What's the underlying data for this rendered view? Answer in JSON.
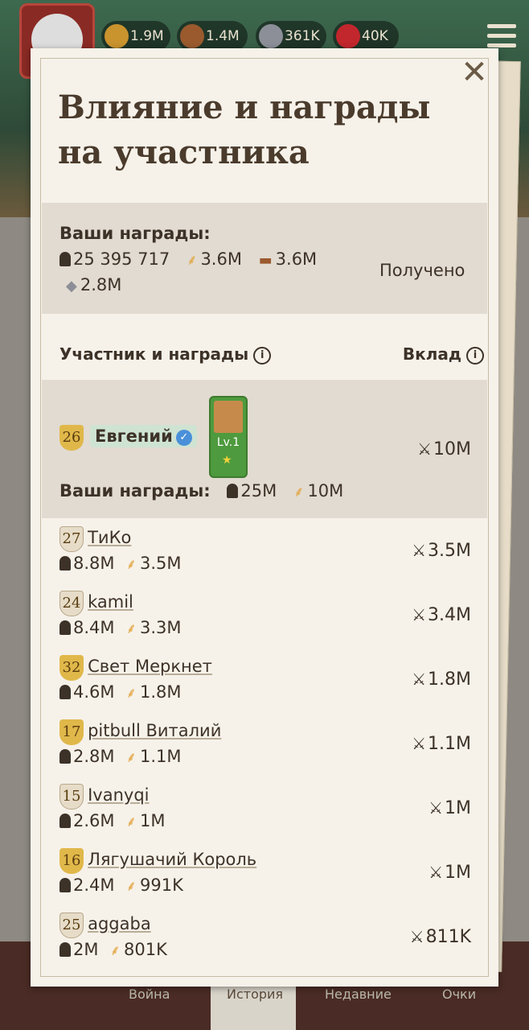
{
  "resources": {
    "grain": "1.9M",
    "wood": "1.4M",
    "stone": "361K",
    "gems": "40K"
  },
  "bottom_tabs": [
    "Война",
    "История",
    "Недавние",
    "Очки"
  ],
  "modal": {
    "title": "Влияние и награды на участника",
    "rewards": {
      "heading": "Ваши награды:",
      "line1": "25 395 717 ⚘ 3.6M ▬ 3.6M",
      "troops": "25 395 717",
      "grain": "3.6M",
      "wood": "3.6M",
      "stone": "2.8M",
      "status": "Получено"
    },
    "header_left": "Участник и награды",
    "header_right": "Вклад",
    "me": {
      "rank": "26",
      "name": "Евгений",
      "hero_level": "Lv.1",
      "contribution": "10M",
      "rewards_label": "Ваши награды:",
      "troops": "25M",
      "extra": "10M"
    },
    "members": [
      {
        "rank": "27",
        "name": "ТиКо",
        "troops": "8.8M",
        "extra": "3.5M",
        "contribution": "3.5M",
        "gold": false
      },
      {
        "rank": "24",
        "name": "kamil",
        "troops": "8.4M",
        "extra": "3.3M",
        "contribution": "3.4M",
        "gold": false
      },
      {
        "rank": "32",
        "name": "Свет Меркнет",
        "troops": "4.6M",
        "extra": "1.8M",
        "contribution": "1.8M",
        "gold": true
      },
      {
        "rank": "17",
        "name": "pitbull Виталий",
        "troops": "2.8M",
        "extra": "1.1M",
        "contribution": "1.1M",
        "gold": true
      },
      {
        "rank": "15",
        "name": "Ivanyqi",
        "troops": "2.6M",
        "extra": "1M",
        "contribution": "1M",
        "gold": false
      },
      {
        "rank": "16",
        "name": "Лягушачий Король",
        "troops": "2.4M",
        "extra": "991K",
        "contribution": "1M",
        "gold": true
      },
      {
        "rank": "25",
        "name": "aggaba",
        "troops": "2M",
        "extra": "801K",
        "contribution": "811K",
        "gold": false
      }
    ]
  }
}
